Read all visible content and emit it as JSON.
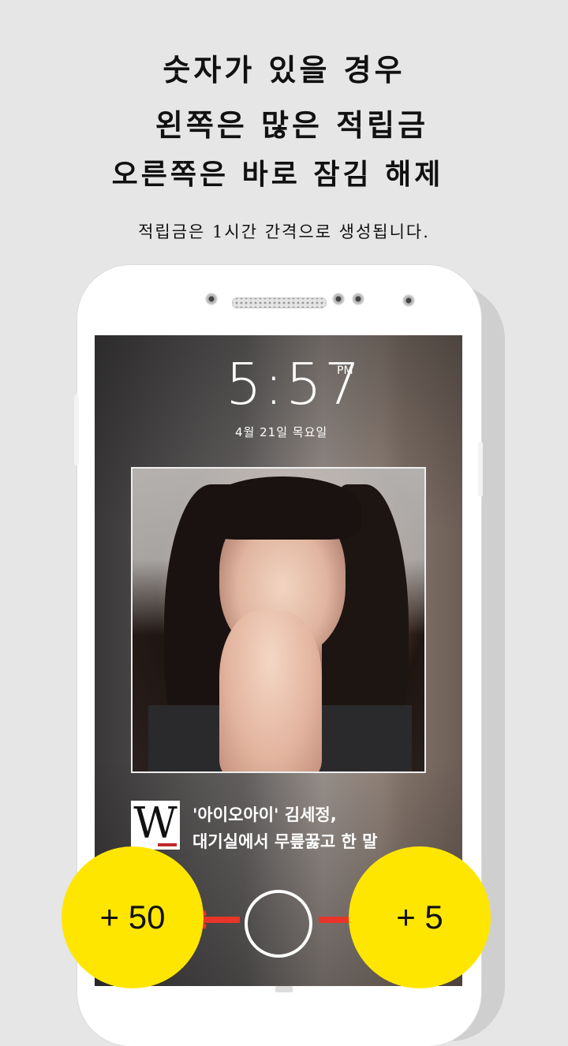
{
  "headlines": {
    "line1": "숫자가 있을 경우",
    "line2": "왼쪽은 많은 적립금",
    "line3": "오른쪽은 바로 잠김 해제",
    "subline": "적립금은 1시간 간격으로 생성됩니다."
  },
  "lockscreen": {
    "time": "5:57",
    "ampm": "PM",
    "date": "4월 21일 목요일"
  },
  "news": {
    "logo": "W",
    "headline_line1": "'아이오아이' 김세정,",
    "headline_line2": "대기실에서 무릎꿇고 한 말"
  },
  "actions": {
    "left_reward": "+ 50",
    "right_reward": "+ 5"
  },
  "colors": {
    "coin": "#ffe600",
    "arrow": "#e8352a",
    "background": "#e6e6e6"
  }
}
